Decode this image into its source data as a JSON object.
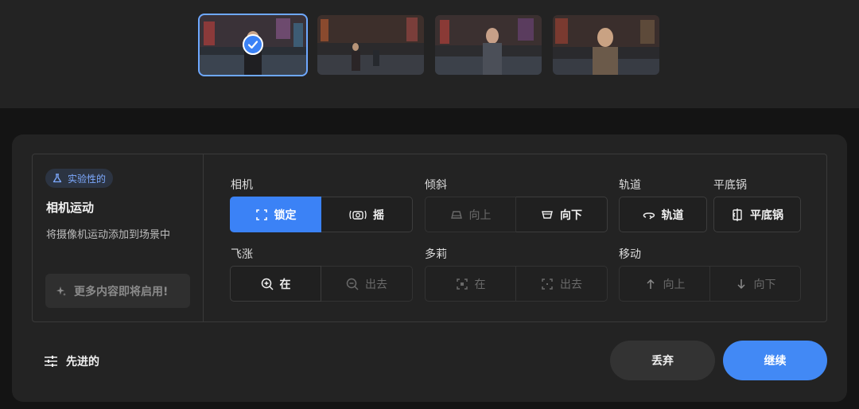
{
  "thumbnails": [
    {
      "name": "thumbnail-1",
      "selected": true
    },
    {
      "name": "thumbnail-2",
      "selected": false
    },
    {
      "name": "thumbnail-3",
      "selected": false
    },
    {
      "name": "thumbnail-4",
      "selected": false
    }
  ],
  "info": {
    "badge": "实验性的",
    "title": "相机运动",
    "description": "将摄像机运动添加到场景中",
    "more_label": "更多内容即将启用!"
  },
  "groups": {
    "camera": {
      "label": "相机",
      "lock": "锁定",
      "shake": "摇"
    },
    "tilt": {
      "label": "倾斜",
      "up": "向上",
      "down": "向下"
    },
    "orbit": {
      "label": "轨道",
      "button": "轨道"
    },
    "pan": {
      "label": "平底锅",
      "button": "平底锅"
    },
    "zoom": {
      "label": "飞涨",
      "in": "在",
      "out": "出去"
    },
    "dolly": {
      "label": "多莉",
      "in": "在",
      "out": "出去"
    },
    "move": {
      "label": "移动",
      "up": "向上",
      "down": "向下"
    }
  },
  "footer": {
    "advanced": "先进的",
    "discard": "丢弃",
    "continue": "继续"
  },
  "colors": {
    "accent": "#3b82f6",
    "badge_text": "#7eaaff"
  }
}
